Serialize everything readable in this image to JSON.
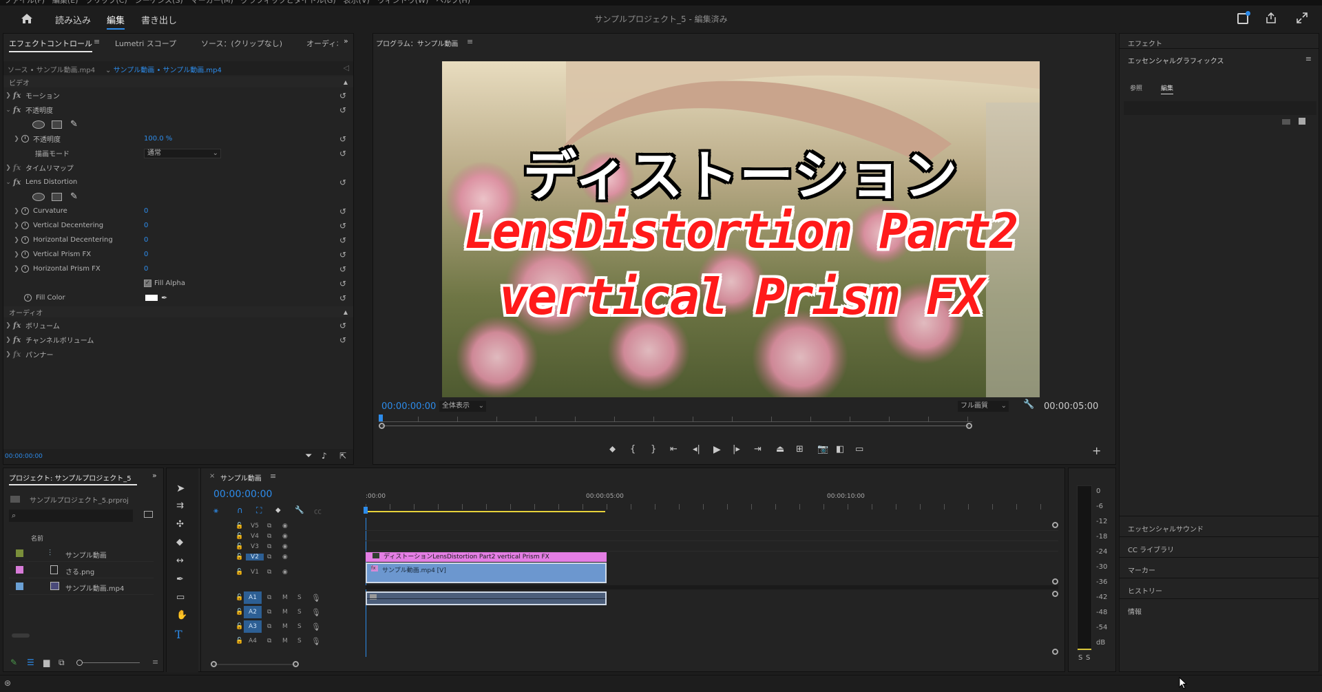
{
  "topbar": {
    "menu_strip": "ファイル(F)　編集(E)　クリップ(C)　シーケンス(S)　マーカー(M)　グラフィックとタイトル(G)　表示(V)　ウィンドウ(W)　ヘルプ(H)",
    "workspaces": [
      "読み込み",
      "編集",
      "書き出し"
    ],
    "active_workspace": "編集",
    "title": "サンプルプロジェクト_5 - 編集済み"
  },
  "effect_controls": {
    "tabs": [
      "エフェクトコントロール",
      "Lumetri スコープ",
      "ソース：(クリップなし)",
      "オーディオ"
    ],
    "source_clip": "ソース • サンプル動画.mp4",
    "seq_clip": "サンプル動画 • サンプル動画.mp4",
    "video_header": "ビデオ",
    "motion": "モーション",
    "opacity": "不透明度",
    "opacity_prop": "不透明度",
    "opacity_value": "100.0 %",
    "blend_mode": "描画モード",
    "blend_value": "通常",
    "time_remap": "タイムリマップ",
    "lens": "Lens Distortion",
    "props": [
      {
        "name": "Curvature",
        "value": "0"
      },
      {
        "name": "Vertical Decentering",
        "value": "0"
      },
      {
        "name": "Horizontal Decentering",
        "value": "0"
      },
      {
        "name": "Vertical Prism FX",
        "value": "0"
      },
      {
        "name": "Horizontal Prism FX",
        "value": "0"
      }
    ],
    "fill_alpha": "Fill Alpha",
    "fill_color": "Fill Color",
    "audio_header": "オーディオ",
    "volume": "ボリューム",
    "channel_volume": "チャンネルボリューム",
    "panner": "パンナー",
    "timecode": "00:00:00:00"
  },
  "program": {
    "title": "プログラム：サンプル動画",
    "line1": "ディストーション",
    "line2": "LensDistortion Part2",
    "line3": "vertical Prism FX",
    "timecode": "00:00:00:00",
    "zoom": "全体表示",
    "quality": "フル画質",
    "duration": "00:00:05:00"
  },
  "right_panel": {
    "effects": "エフェクト",
    "eg_title": "エッセンシャルグラフィックス",
    "eg_tabs": [
      "参照",
      "編集"
    ],
    "sections": [
      "エッセンシャルサウンド",
      "CC ライブラリ",
      "マーカー",
      "ヒストリー",
      "情報"
    ]
  },
  "project": {
    "title": "プロジェクト: サンプルプロジェクト_5",
    "file": "サンプルプロジェクト_5.prproj",
    "col_name": "名前",
    "items": [
      {
        "name": "サンプル動画",
        "color": "#7a8f3a"
      },
      {
        "name": "さる.png",
        "color": "#d77bd8"
      },
      {
        "name": "サンプル動画.mp4",
        "color": "#6aa0d4"
      }
    ]
  },
  "timeline": {
    "title": "サンプル動画",
    "timecode": "00:00:00:00",
    "ruler": [
      ":00:00",
      "00:00:05:00",
      "00:00:10:00"
    ],
    "video_tracks": [
      "V5",
      "V4",
      "V3",
      "V2",
      "V1"
    ],
    "audio_tracks": [
      "A1",
      "A2",
      "A3",
      "A4"
    ],
    "title_clip": "ディストーションLensDistortion Part2 vertical Prism FX",
    "video_clip": "サンプル動画.mp4 [V]",
    "m": "M",
    "s": "S"
  },
  "meter": {
    "ticks": [
      "0",
      "-6",
      "-12",
      "-18",
      "-24",
      "-30",
      "-36",
      "-42",
      "-48",
      "-54",
      "dB"
    ],
    "solo": [
      "S",
      "S"
    ]
  }
}
